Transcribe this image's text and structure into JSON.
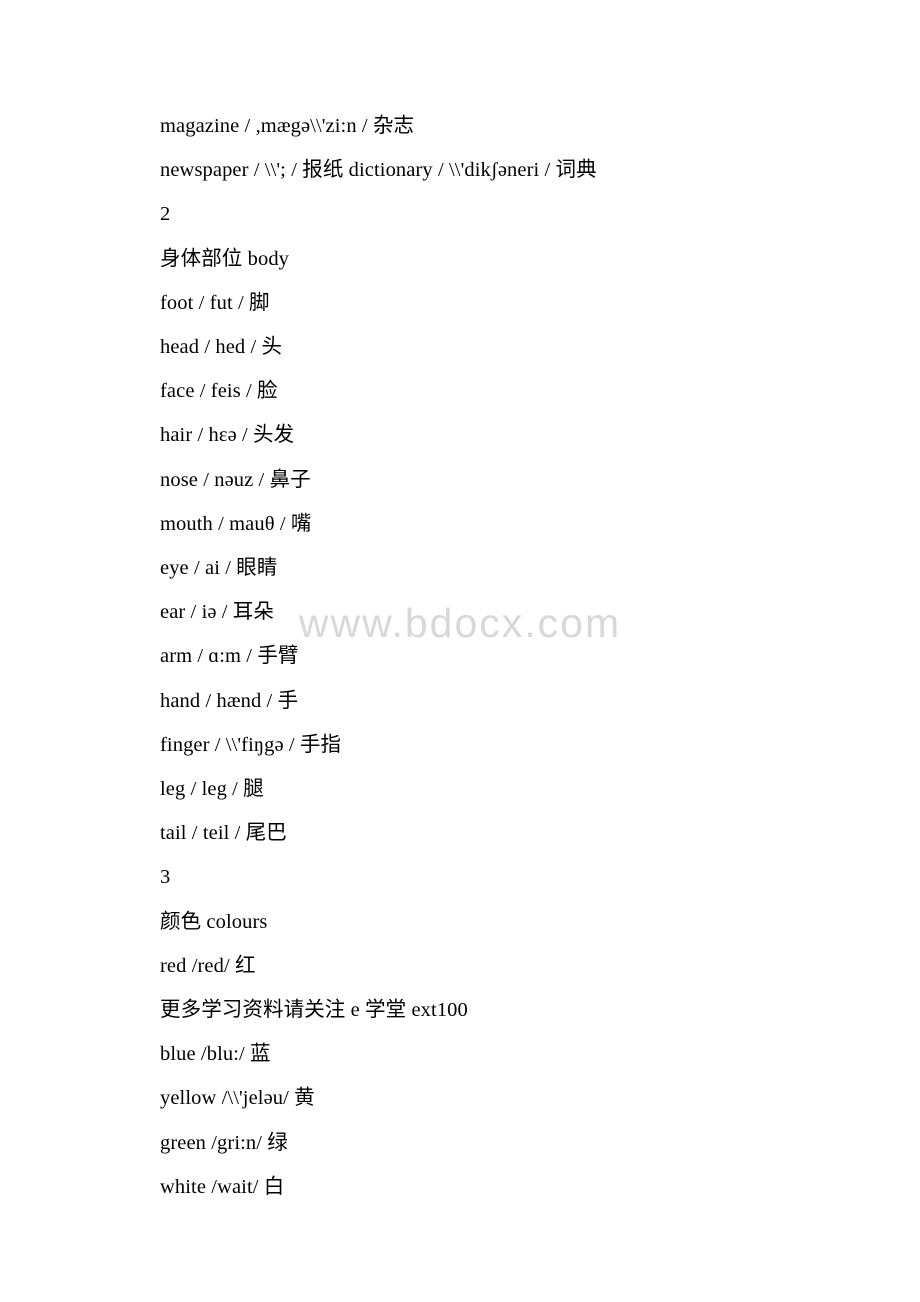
{
  "document": {
    "watermark": "www.bdocx.com",
    "lines": [
      "magazine / ,mægə\\\\'zi:n / 杂志",
      "newspaper / \\\\'; / 报纸 dictionary / \\\\'dikʃəneri / 词典",
      "2",
      "身体部位 body",
      "foot / fut / 脚",
      "head / hed / 头",
      "face / feis / 脸",
      "hair / hɛə / 头发",
      "nose / nəuz / 鼻子",
      "mouth / mauθ / 嘴",
      "eye / ai / 眼睛",
      "ear / iə / 耳朵",
      "arm / ɑ:m / 手臂",
      "hand / hænd / 手",
      "finger / \\\\'fiŋgə / 手指",
      "leg / leg / 腿",
      "tail / teil / 尾巴",
      "3",
      "颜色 colours",
      "red /red/ 红",
      "更多学习资料请关注 e 学堂 ext100",
      "blue /blu:/ 蓝",
      "yellow /\\\\'jeləu/ 黄",
      "green /gri:n/ 绿",
      "white /wait/ 白"
    ]
  }
}
